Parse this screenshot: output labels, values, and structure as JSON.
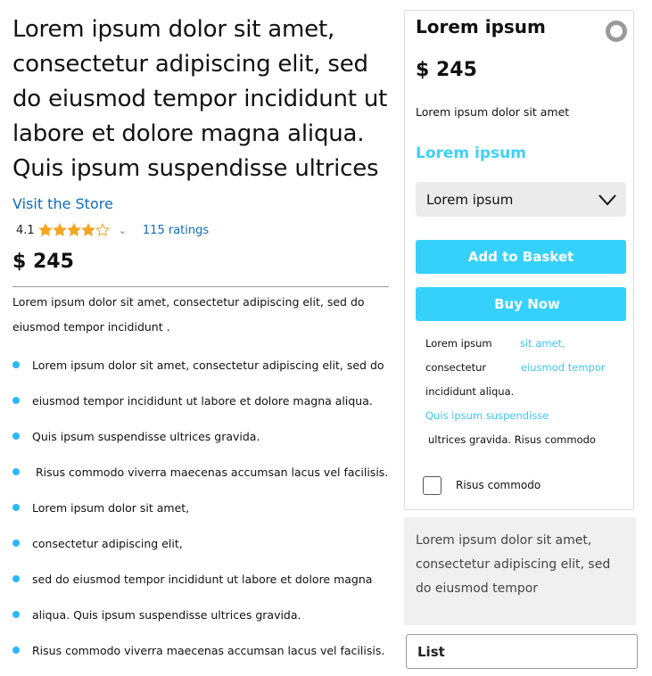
{
  "product": {
    "title": "Lorem ipsum dolor sit amet, consectetur adipiscing elit, sed do eiusmod tempor incididunt ut labore et dolore magna aliqua. Quis ipsum suspendisse ultrices",
    "store_link": "Visit the Store",
    "rating_value": "4.1",
    "rating_stars": 4.1,
    "ratings_count": "115 ratings",
    "price": "$ 245",
    "description": "Lorem ipsum dolor sit amet, consectetur adipiscing elit, sed do eiusmod tempor incididunt .",
    "bullets": [
      "Lorem ipsum dolor sit amet, consectetur adipiscing elit, sed do",
      "eiusmod tempor incididunt ut labore et dolore magna aliqua.",
      "Quis ipsum suspendisse ultrices gravida.",
      " Risus commodo viverra maecenas accumsan lacus vel facilisis.",
      "Lorem ipsum dolor sit amet,",
      "consectetur adipiscing elit,",
      "sed do eiusmod tempor incididunt ut labore et dolore magna",
      "aliqua. Quis ipsum suspendisse ultrices gravida.",
      "Risus commodo viverra maecenas accumsan lacus vel facilisis."
    ]
  },
  "card": {
    "title": "Lorem ipsum",
    "price": "$ 245",
    "subtitle": "Lorem ipsum dolor sit amet",
    "accent_heading": "Lorem ipsum",
    "select_value": "Lorem ipsum",
    "add_to_basket": "Add to Basket",
    "buy_now": "Buy Now",
    "info": {
      "line1_label": "Lorem ipsum",
      "line1_link": "sit amet,",
      "line2_label": "consectetur",
      "line2_link": "eiusmod tempor",
      "line3_text": "incididunt aliqua.",
      "line4_link": "Quis ipsum suspendisse",
      "line5_text": "ultrices gravida. Risus commodo"
    },
    "checkbox_label": "Risus commodo"
  },
  "note": "Lorem ipsum dolor sit amet, consectetur adipiscing elit, sed do eiusmod tempor",
  "list_field": "List",
  "colors": {
    "link_blue": "#0f6cbd",
    "accent_cyan": "#36d1fb",
    "star_orange": "#f5a623",
    "bullet_blue": "#29b8ff"
  },
  "icons": {
    "star": "star-icon",
    "dropdown": "chevron-down-icon",
    "radio": "radio-icon"
  }
}
